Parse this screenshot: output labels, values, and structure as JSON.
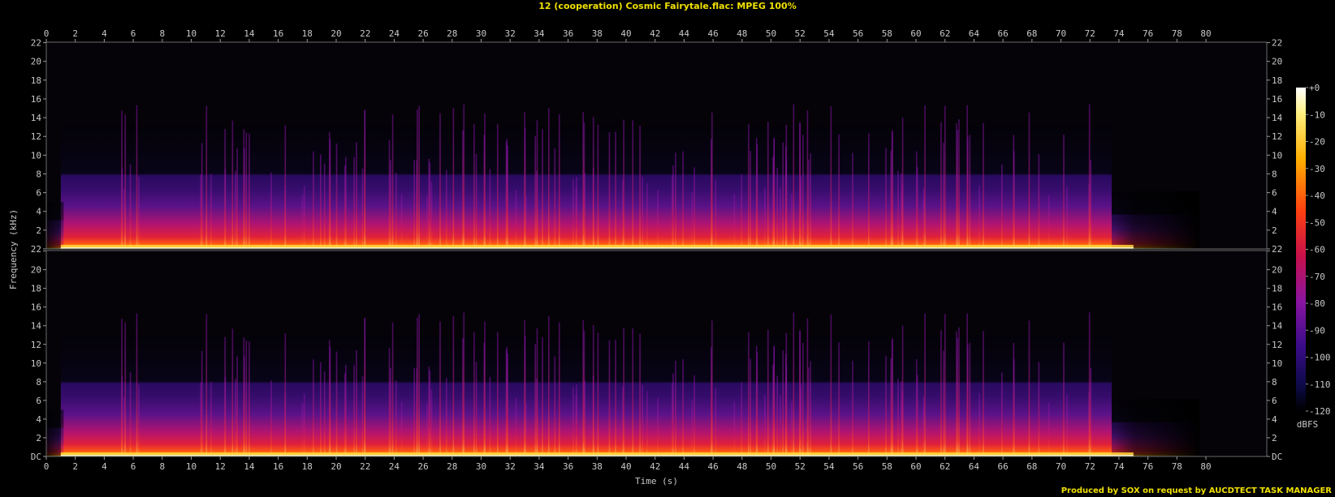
{
  "title": "12 (cooperation) Cosmic Fairytale.flac: MPEG 100%",
  "footer": "Produced by SOX on request by AUCDTECT TASK MANAGER",
  "chart_data": {
    "type": "heatmap",
    "title": "12 (cooperation) Cosmic Fairytale.flac: MPEG 100%",
    "xlabel": "Time (s)",
    "ylabel": "Frequency (kHz)",
    "xlim": [
      0,
      84.2
    ],
    "ylim": [
      0,
      22.05
    ],
    "x_ticks": [
      0,
      2,
      4,
      6,
      8,
      10,
      12,
      14,
      16,
      18,
      20,
      22,
      24,
      26,
      28,
      30,
      32,
      34,
      36,
      38,
      40,
      42,
      44,
      46,
      48,
      50,
      52,
      54,
      56,
      58,
      60,
      62,
      64,
      66,
      68,
      70,
      72,
      74,
      76,
      78,
      80
    ],
    "y_ticks": [
      {
        "v": 0,
        "label": "DC"
      },
      {
        "v": 2,
        "label": "2"
      },
      {
        "v": 4,
        "label": "4"
      },
      {
        "v": 6,
        "label": "6"
      },
      {
        "v": 8,
        "label": "8"
      },
      {
        "v": 10,
        "label": "10"
      },
      {
        "v": 12,
        "label": "12"
      },
      {
        "v": 14,
        "label": "14"
      },
      {
        "v": 16,
        "label": "16"
      },
      {
        "v": 18,
        "label": "18"
      },
      {
        "v": 20,
        "label": "20"
      },
      {
        "v": 22,
        "label": "22"
      }
    ],
    "channels": 2,
    "colorbar": {
      "label": "dBFS",
      "range": [
        -120,
        0
      ],
      "ticks": [
        "+0",
        "-10",
        "-20",
        "-30",
        "-40",
        "-50",
        "-60",
        "-70",
        "-80",
        "-90",
        "-100",
        "-110",
        "-120"
      ]
    },
    "features": {
      "lowpass_cutoff_khz": 13,
      "content_end_s": 73.5,
      "fade_end_s": 79.5,
      "transient_spikes_max_khz": 15.5
    }
  }
}
